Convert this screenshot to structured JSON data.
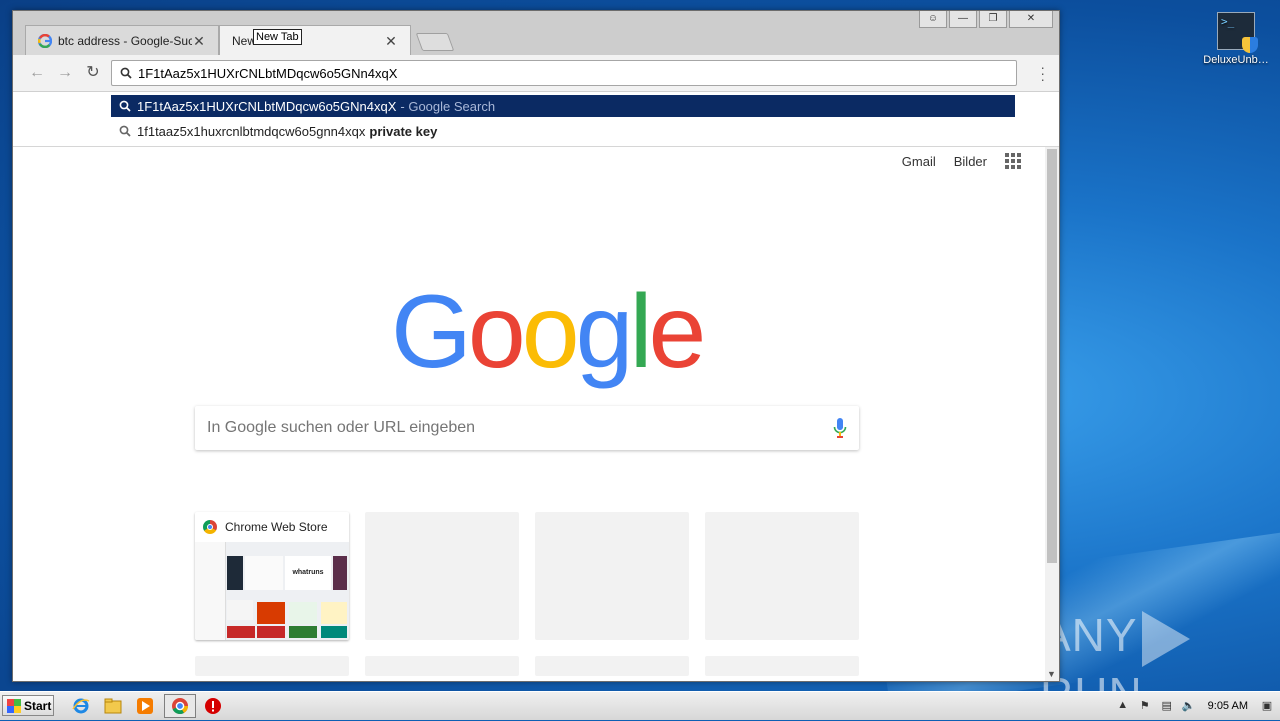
{
  "desktop": {
    "icon_label": "DeluxeUnb…",
    "watermark": {
      "left": "ANY",
      "right": "RUN"
    }
  },
  "browser": {
    "tabs": [
      {
        "title": "btc address - Google-Suche",
        "favicon": "google-g-icon"
      },
      {
        "title": "New Tab",
        "favicon": ""
      }
    ],
    "tooltip": "New Tab",
    "omnibox_value": "1F1tAaz5x1HUXrCNLbtMDqcw6o5GNn4xqX",
    "suggestions": [
      {
        "text": "1F1tAaz5x1HUXrCNLbtMDqcw6o5GNn4xqX",
        "suffix": "- Google Search"
      },
      {
        "text": "1f1taaz5x1huxrcnlbtmdqcw6o5gnn4xqx",
        "bold": "private key"
      }
    ]
  },
  "page": {
    "links": {
      "gmail": "Gmail",
      "images": "Bilder"
    },
    "logo": [
      "G",
      "o",
      "o",
      "g",
      "l",
      "e"
    ],
    "logo_colors": [
      "#4285F4",
      "#EA4335",
      "#FBBC05",
      "#4285F4",
      "#34A853",
      "#EA4335"
    ],
    "search_placeholder": "In Google suchen oder URL eingeben",
    "tiles": [
      {
        "title": "Chrome Web Store",
        "filled": true
      },
      {
        "title": "",
        "filled": false
      },
      {
        "title": "",
        "filled": false
      },
      {
        "title": "",
        "filled": false
      }
    ],
    "thumbnail_text": "whatruns"
  },
  "taskbar": {
    "start_label": "Start",
    "clock": "9:05 AM"
  },
  "colors": {
    "selection": "#0b2a63",
    "desktop": "#1a73c8"
  }
}
